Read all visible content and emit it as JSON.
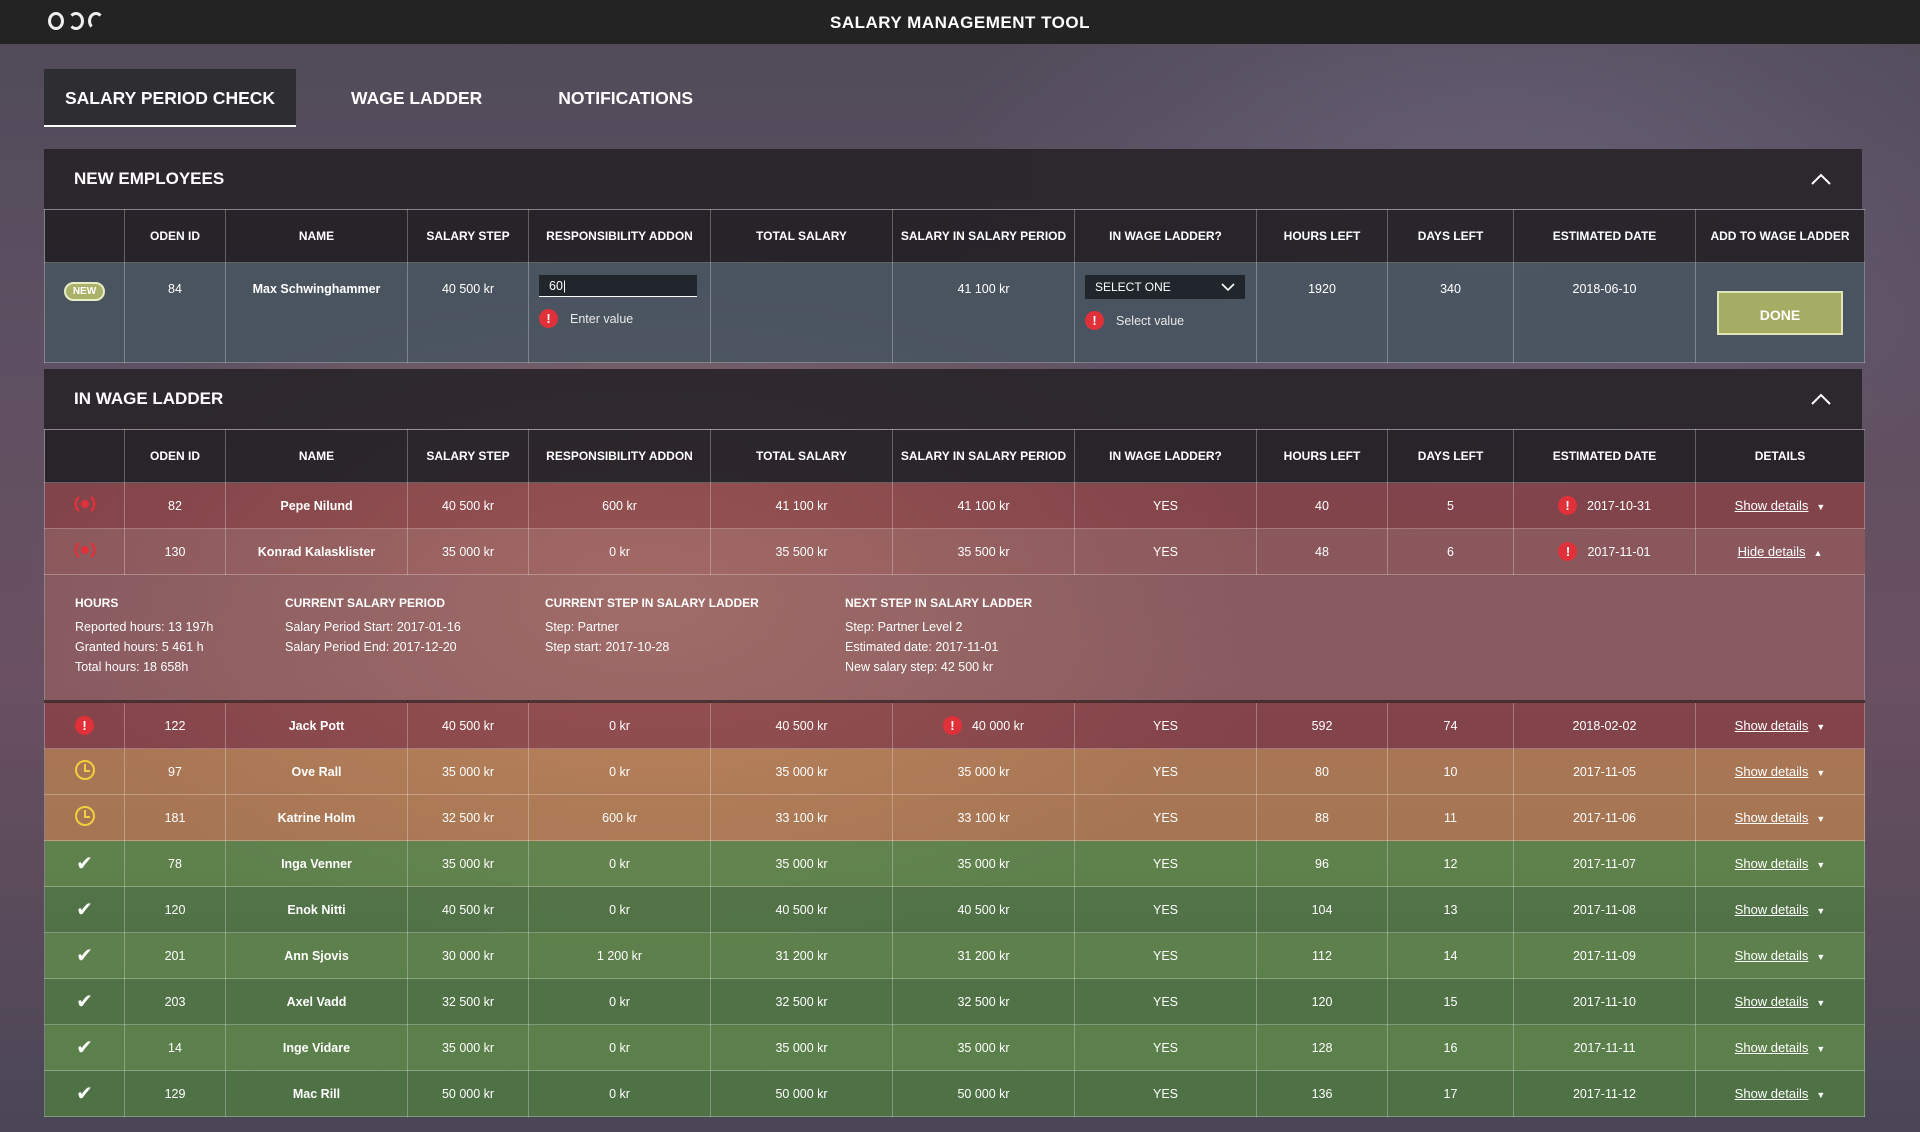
{
  "app": {
    "title": "SALARY MANAGEMENT TOOL"
  },
  "tabs": [
    {
      "label": "SALARY PERIOD CHECK",
      "active": true
    },
    {
      "label": "WAGE LADDER",
      "active": false
    },
    {
      "label": "NOTIFICATIONS",
      "active": false
    }
  ],
  "new_employees": {
    "title": "NEW EMPLOYEES",
    "columns": [
      "",
      "ODEN ID",
      "NAME",
      "SALARY STEP",
      "RESPONSIBILITY ADDON",
      "TOTAL SALARY",
      "SALARY IN SALARY PERIOD",
      "IN WAGE LADDER?",
      "HOURS LEFT",
      "DAYS LEFT",
      "ESTIMATED DATE",
      "ADD TO WAGE LADDER"
    ],
    "row": {
      "badge": "NEW",
      "id": "84",
      "name": "Max Schwinghammer",
      "salary_step": "40 500 kr",
      "responsibility_value": "60|",
      "responsibility_error": "Enter value",
      "total_salary": "",
      "salary_in_period": "41 100 kr",
      "wage_ladder_select": "SELECT ONE",
      "wage_ladder_error": "Select value",
      "hours_left": "1920",
      "days_left": "340",
      "estimated_date": "2018-06-10",
      "done_label": "DONE"
    }
  },
  "wage_ladder": {
    "title": "IN WAGE LADDER",
    "columns": [
      "",
      "ODEN ID",
      "NAME",
      "SALARY STEP",
      "RESPONSIBILITY ADDON",
      "TOTAL SALARY",
      "SALARY IN SALARY PERIOD",
      "IN WAGE LADDER?",
      "HOURS LEFT",
      "DAYS LEFT",
      "ESTIMATED DATE",
      "DETAILS"
    ],
    "rows_top": [
      {
        "status": "signal",
        "id": "82",
        "name": "Pepe Nilund",
        "salary_step": "40 500 kr",
        "addon": "600 kr",
        "total": "41 100 kr",
        "period": "41 100 kr",
        "in_ladder": "YES",
        "hours": "40",
        "days": "5",
        "date": "2017-10-31",
        "date_alert": true,
        "details": "Show details"
      },
      {
        "status": "signal",
        "id": "130",
        "name": "Konrad Kalasklister",
        "salary_step": "35 000 kr",
        "addon": "0 kr",
        "total": "35 500 kr",
        "period": "35 500 kr",
        "in_ladder": "YES",
        "hours": "48",
        "days": "6",
        "date": "2017-11-01",
        "date_alert": true,
        "details": "Hide details"
      }
    ],
    "expanded_details": {
      "hours": {
        "heading": "HOURS",
        "lines": [
          "Reported hours: 13 197h",
          "Granted hours: 5 461 h",
          "Total hours: 18 658h"
        ]
      },
      "current_period": {
        "heading": "CURRENT SALARY PERIOD",
        "lines": [
          "Salary Period Start: 2017-01-16",
          "Salary Period End: 2017-12-20"
        ]
      },
      "current_step": {
        "heading": "CURRENT STEP IN SALARY LADDER",
        "lines": [
          "Step:  Partner",
          "Step start: 2017-10-28"
        ]
      },
      "next_step": {
        "heading": "NEXT STEP IN SALARY LADDER",
        "lines": [
          "Step:  Partner Level 2",
          "Estimated date: 2017-11-01",
          "New salary step: 42 500 kr"
        ]
      }
    },
    "rows_bottom": [
      {
        "status": "alert",
        "id": "122",
        "name": "Jack Pott",
        "salary_step": "40 500 kr",
        "addon": "0 kr",
        "total": "40 500 kr",
        "period": "40 000 kr",
        "period_alert": true,
        "in_ladder": "YES",
        "hours": "592",
        "days": "74",
        "date": "2018-02-02",
        "details": "Show details"
      },
      {
        "status": "clock",
        "id": "97",
        "name": "Ove Rall",
        "salary_step": "35 000 kr",
        "addon": "0 kr",
        "total": "35 000 kr",
        "period": "35 000 kr",
        "in_ladder": "YES",
        "hours": "80",
        "days": "10",
        "date": "2017-11-05",
        "details": "Show details"
      },
      {
        "status": "clock",
        "id": "181",
        "name": "Katrine Holm",
        "salary_step": "32 500 kr",
        "addon": "600 kr",
        "total": "33 100 kr",
        "period": "33 100 kr",
        "in_ladder": "YES",
        "hours": "88",
        "days": "11",
        "date": "2017-11-06",
        "details": "Show details"
      },
      {
        "status": "check",
        "id": "78",
        "name": "Inga Venner",
        "salary_step": "35 000 kr",
        "addon": "0 kr",
        "total": "35 000 kr",
        "period": "35 000 kr",
        "in_ladder": "YES",
        "hours": "96",
        "days": "12",
        "date": "2017-11-07",
        "details": "Show details"
      },
      {
        "status": "check",
        "id": "120",
        "name": "Enok Nitti",
        "salary_step": "40 500 kr",
        "addon": "0 kr",
        "total": "40 500 kr",
        "period": "40 500 kr",
        "in_ladder": "YES",
        "hours": "104",
        "days": "13",
        "date": "2017-11-08",
        "details": "Show details"
      },
      {
        "status": "check",
        "id": "201",
        "name": "Ann Sjovis",
        "salary_step": "30 000 kr",
        "addon": "1 200 kr",
        "total": "31 200 kr",
        "period": "31 200 kr",
        "in_ladder": "YES",
        "hours": "112",
        "days": "14",
        "date": "2017-11-09",
        "details": "Show details"
      },
      {
        "status": "check",
        "id": "203",
        "name": "Axel Vadd",
        "salary_step": "32 500 kr",
        "addon": "0 kr",
        "total": "32 500 kr",
        "period": "32 500 kr",
        "in_ladder": "YES",
        "hours": "120",
        "days": "15",
        "date": "2017-11-10",
        "details": "Show details"
      },
      {
        "status": "check",
        "id": "14",
        "name": "Inge Vidare",
        "salary_step": "35 000 kr",
        "addon": "0 kr",
        "total": "35 000 kr",
        "period": "35 000 kr",
        "in_ladder": "YES",
        "hours": "128",
        "days": "16",
        "date": "2017-11-11",
        "details": "Show details"
      },
      {
        "status": "check",
        "id": "129",
        "name": "Mac Rill",
        "salary_step": "50 000 kr",
        "addon": "0 kr",
        "total": "50 000 kr",
        "period": "50 000 kr",
        "in_ladder": "YES",
        "hours": "136",
        "days": "17",
        "date": "2017-11-12",
        "details": "Show details"
      }
    ]
  },
  "icons": {
    "alert": "exclamation-circle-icon",
    "signal": "signal-broadcast-icon",
    "clock": "clock-icon",
    "check": "checkmark-icon",
    "collapse": "chevron-up-icon"
  },
  "colors": {
    "alert": "#e0303a",
    "warning": "#f2cf3c",
    "done_button": "#a4ad63"
  }
}
